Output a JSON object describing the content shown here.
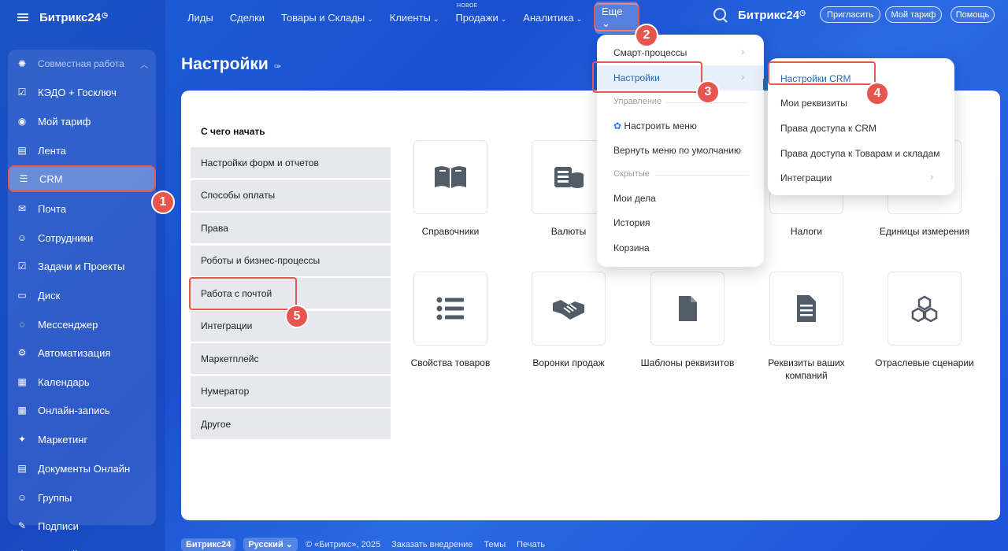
{
  "app": {
    "logo": "Битрикс24",
    "clock_glyph": "◷"
  },
  "sidebar": {
    "group": "Совместная работа",
    "items": [
      {
        "label": "КЭДО + Госключ",
        "icon": "document-check-icon",
        "glyph": "☑"
      },
      {
        "label": "Мой тариф",
        "icon": "tariff-icon",
        "glyph": "◉"
      },
      {
        "label": "Лента",
        "icon": "feed-icon",
        "glyph": "▤"
      },
      {
        "label": "CRM",
        "icon": "crm-funnel-icon",
        "glyph": "☰"
      },
      {
        "label": "Почта",
        "icon": "mail-icon",
        "glyph": "✉"
      },
      {
        "label": "Сотрудники",
        "icon": "employees-icon",
        "glyph": "☺"
      },
      {
        "label": "Задачи и Проекты",
        "icon": "tasks-icon",
        "glyph": "☑"
      },
      {
        "label": "Диск",
        "icon": "disk-icon",
        "glyph": "▭"
      },
      {
        "label": "Мессенджер",
        "icon": "messenger-icon",
        "glyph": "◌"
      },
      {
        "label": "Автоматизация",
        "icon": "automation-icon",
        "glyph": "⚙"
      },
      {
        "label": "Календарь",
        "icon": "calendar-icon",
        "glyph": "▦"
      },
      {
        "label": "Онлайн-запись",
        "icon": "booking-icon",
        "glyph": "▦"
      },
      {
        "label": "Маркетинг",
        "icon": "marketing-icon",
        "glyph": "✦"
      },
      {
        "label": "Документы Онлайн",
        "icon": "documents-icon",
        "glyph": "▤"
      },
      {
        "label": "Группы",
        "icon": "groups-icon",
        "glyph": "☺"
      },
      {
        "label": "Подписи",
        "icon": "signature-icon",
        "glyph": "✎"
      },
      {
        "label": "Настройки",
        "icon": "settings-icon",
        "glyph": "⚙"
      }
    ]
  },
  "topnav": {
    "items": [
      "Лиды",
      "Сделки",
      "Товары и Склады",
      "Клиенты",
      "Продажи",
      "Аналитика"
    ],
    "chevron": "⌄",
    "new_tag": "НОВОЕ",
    "more": "Еще ⌄",
    "logo": "Битрикс24",
    "invite": "Пригласить",
    "tariff": "Мой тариф",
    "help": "Помощь"
  },
  "page": {
    "title": "Настройки",
    "pin_glyph": "✑"
  },
  "left_menu": {
    "title": "С чего начать",
    "items": [
      "Настройки форм и отчетов",
      "Способы оплаты",
      "Права",
      "Роботы и бизнес-процессы",
      "Работа с почтой",
      "Интеграции",
      "Маркетплейс",
      "Нумератор",
      "Другое"
    ]
  },
  "tiles": {
    "row1": [
      "Справочники",
      "Валюты",
      "Налоги",
      "Единицы измерения"
    ],
    "row2": [
      "Свойства товаров",
      "Воронки продаж",
      "Шаблоны реквизитов",
      "Реквизиты ваших компаний",
      "Отраслевые сценарии"
    ]
  },
  "dropdown_more": {
    "smart": "Смарт-процессы",
    "settings": "Настройки",
    "manage": "Управление",
    "configure": "Настроить меню",
    "reset": "Вернуть меню по умолчанию",
    "hidden": "Скрытые",
    "my_tasks": "Мои дела",
    "history": "История",
    "cart": "Корзина",
    "chevron": "›"
  },
  "dropdown_settings": {
    "crm_settings": "Настройки CRM",
    "requisites": "Мои реквизиты",
    "crm_access": "Права доступа к CRM",
    "goods_access": "Права доступа к Товарам и складам",
    "integrations": "Интеграции",
    "chevron": "›"
  },
  "badges": [
    "1",
    "2",
    "3",
    "4",
    "5"
  ],
  "footer": {
    "logo": "Битрикс24",
    "lang": "Русский ⌄",
    "copyright": "© «Битрикс», 2025",
    "order": "Заказать внедрение",
    "themes": "Темы",
    "print": "Печать"
  },
  "colors": {
    "accent_red": "#e8554f",
    "link_blue": "#2067b0",
    "bg_blue": "#1f5fd6"
  }
}
